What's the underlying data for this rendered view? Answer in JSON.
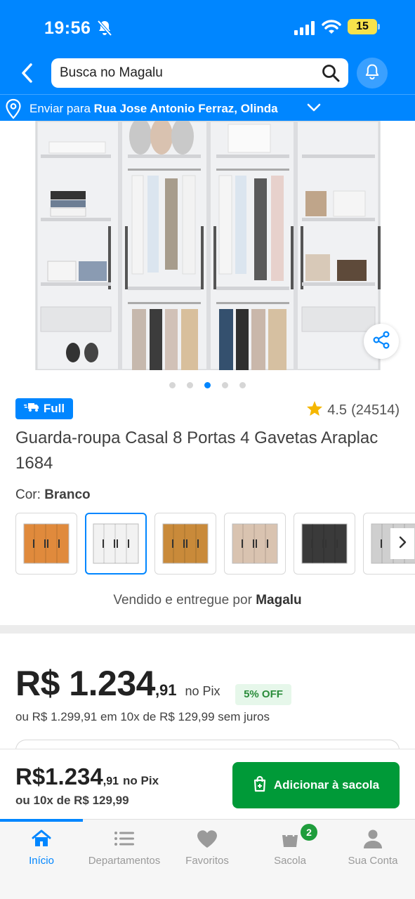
{
  "status_bar": {
    "time": "19:56",
    "battery": "15"
  },
  "header": {
    "search_placeholder": "Busca no Magalu",
    "ship_prefix": "Enviar para",
    "ship_address": "Rua Jose Antonio Ferraz, Olinda"
  },
  "gallery": {
    "dots": 5,
    "active_dot": 3
  },
  "product": {
    "badge": "Full",
    "rating": "4.5",
    "rating_count": "(24514)",
    "title": "Guarda-roupa Casal 8 Portas 4 Gavetas Araplac 1684",
    "color_label": "Cor:",
    "color_value": "Branco",
    "sold_by_prefix": "Vendido e entregue por",
    "sold_by": "Magalu",
    "swatch_colors": [
      "#e08a3c",
      "#f2f2f2",
      "#c98a3a",
      "#d9c3b0",
      "#3a3a3a",
      "#cfcfcf"
    ],
    "selected_swatch": 1
  },
  "price": {
    "main": "R$ 1.234",
    "cents": ",91",
    "pix_label": "no Pix",
    "discount": "5% OFF",
    "installments": "ou R$ 1.299,91 em 10x de R$ 129,99 sem juros"
  },
  "buybar": {
    "price": "R$1.234",
    "cents": ",91",
    "pix_label": "no Pix",
    "installments": "ou 10x de R$ 129,99",
    "button_label": "Adicionar à sacola"
  },
  "tabbar": {
    "items": [
      {
        "label": "Início",
        "icon": "home-icon",
        "active": true
      },
      {
        "label": "Departamentos",
        "icon": "menu-icon",
        "active": false
      },
      {
        "label": "Favoritos",
        "icon": "heart-icon",
        "active": false
      },
      {
        "label": "Sacola",
        "icon": "bag-icon",
        "active": false
      },
      {
        "label": "Sua Conta",
        "icon": "user-icon",
        "active": false
      }
    ],
    "bag_count": "2"
  },
  "colors": {
    "brand_blue": "#0086ff",
    "buy_green": "#009a38"
  }
}
